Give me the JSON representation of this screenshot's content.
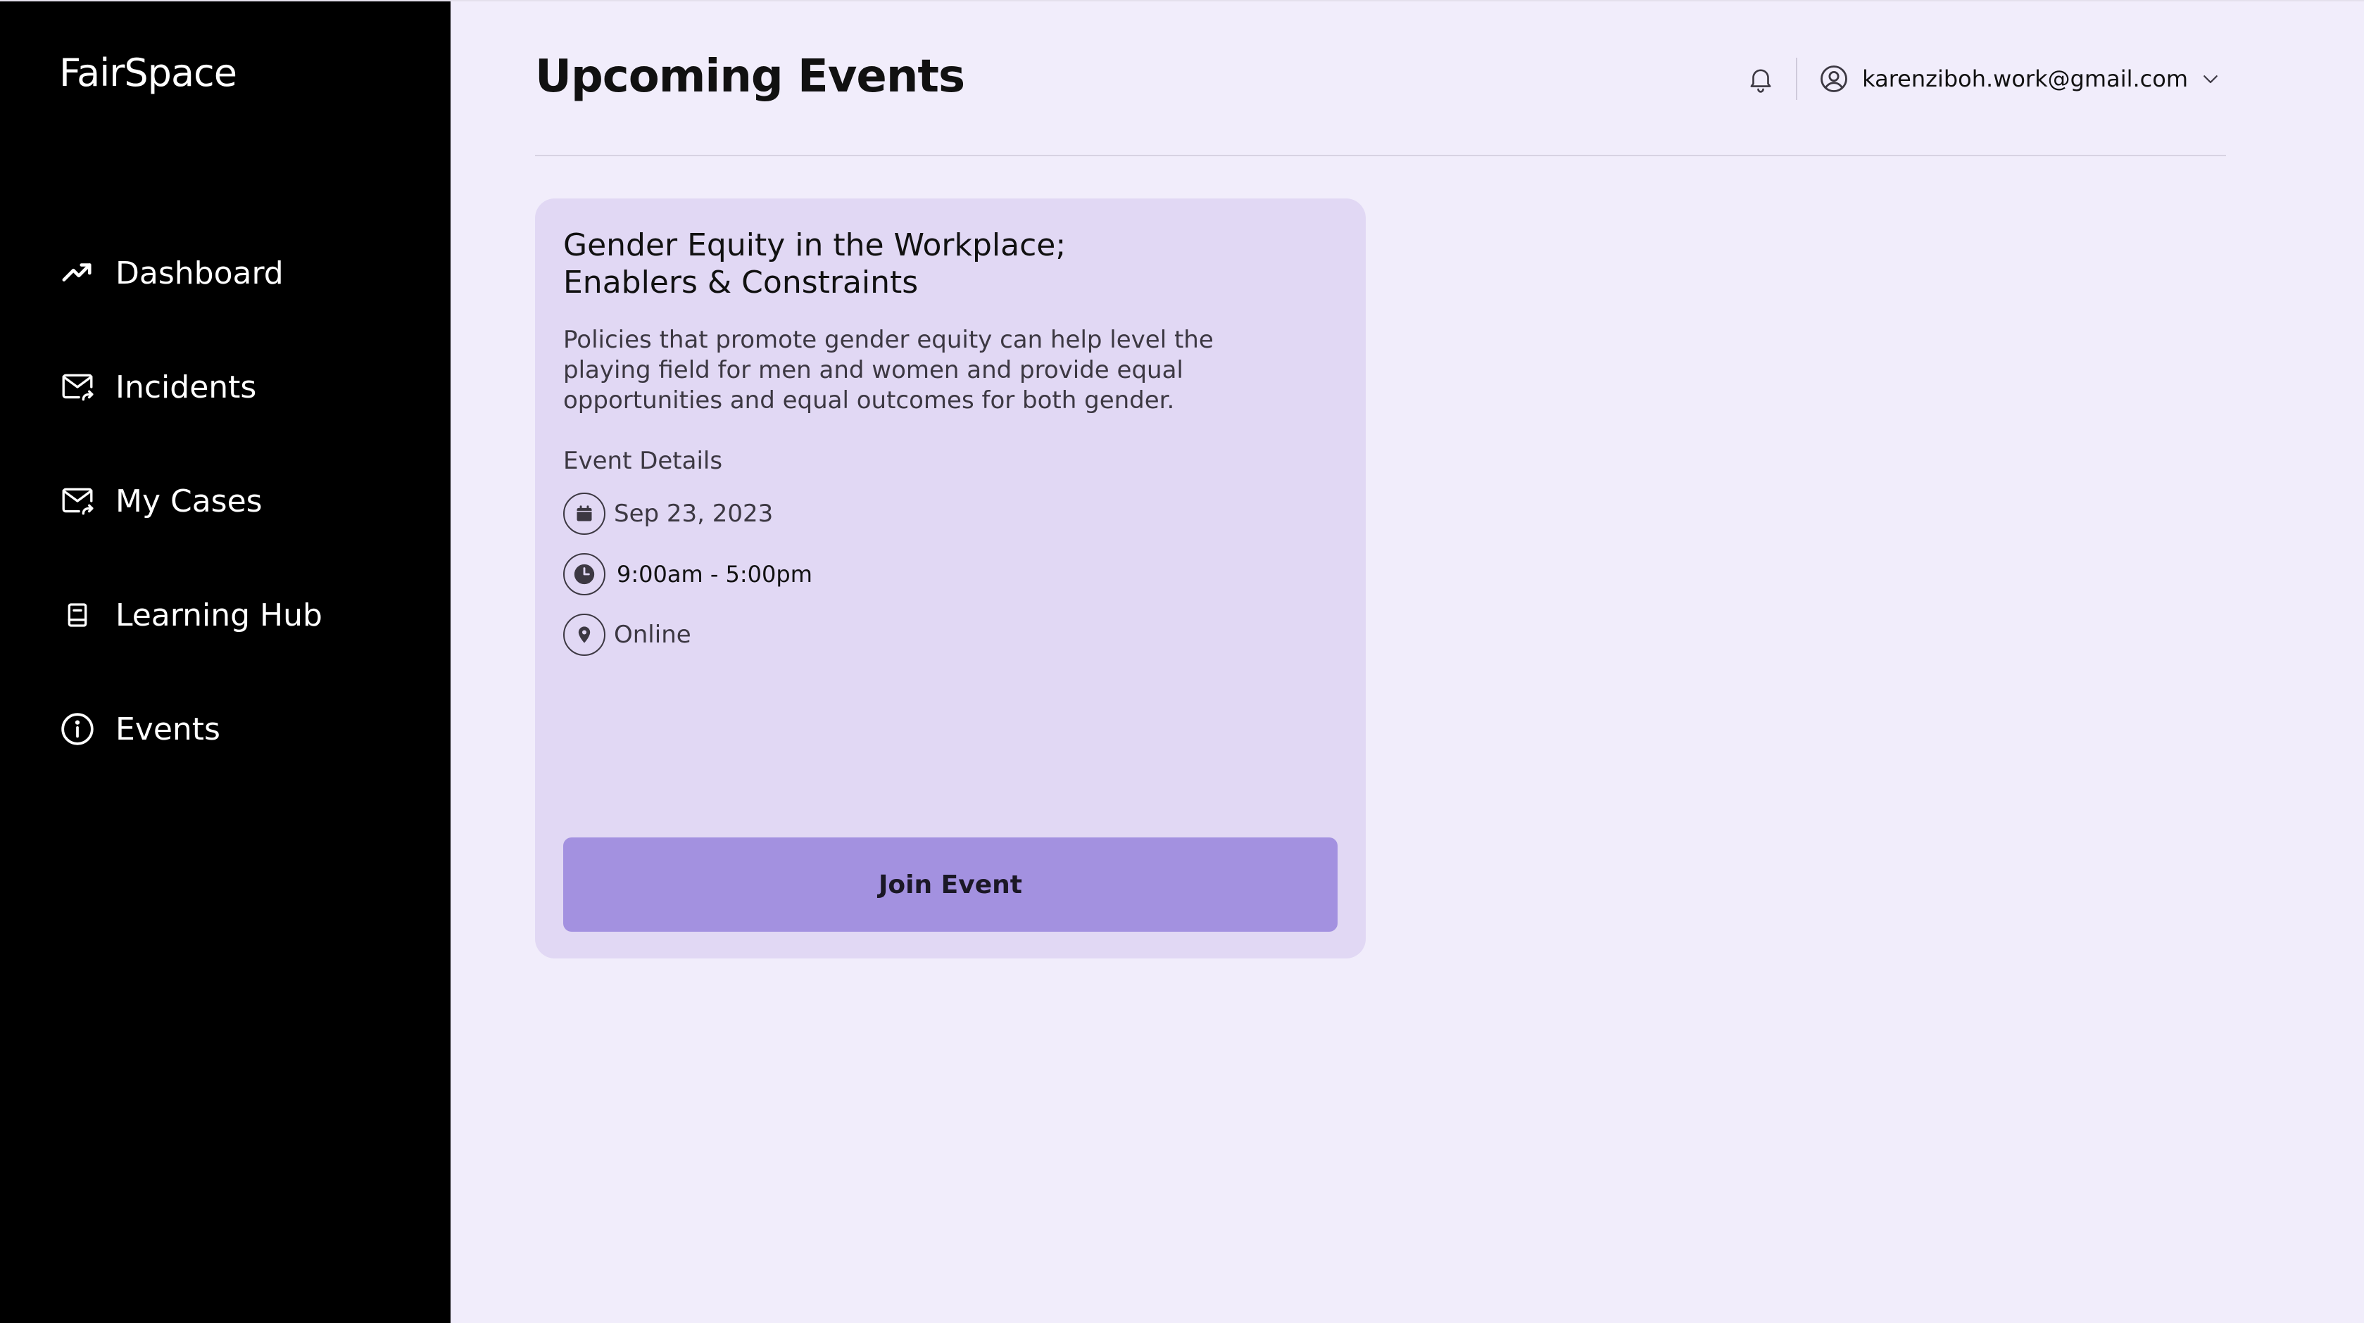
{
  "sidebar": {
    "brand": "FairSpace",
    "items": [
      {
        "label": "Dashboard",
        "icon": "trending-up-icon"
      },
      {
        "label": "Incidents",
        "icon": "mail-forward-icon"
      },
      {
        "label": "My Cases",
        "icon": "mail-forward-icon"
      },
      {
        "label": "Learning Hub",
        "icon": "book-icon"
      },
      {
        "label": "Events",
        "icon": "info-circle-icon"
      }
    ]
  },
  "header": {
    "title": "Upcoming Events",
    "user_email": "karenziboh.work@gmail.com",
    "icons": {
      "notifications": "bell-icon",
      "user": "user-circle-icon",
      "menu": "chevron-down-icon"
    }
  },
  "event_card": {
    "title": "Gender Equity in the Workplace; Enablers & Constraints",
    "description": "Policies that promote gender equity can help level the playing field for men and women and provide equal opportunities and equal outcomes for both gender.",
    "details_heading": "Event Details",
    "date": "Sep 23, 2023",
    "time": "9:00am - 5:00pm",
    "location": "Online",
    "icons": {
      "date": "calendar-icon",
      "time": "clock-icon",
      "location": "map-pin-icon"
    },
    "button_label": "Join Event"
  },
  "colors": {
    "sidebar_bg": "#000000",
    "main_bg": "#f1edfb",
    "card_bg": "#e1d8f4",
    "button_bg": "#a391e0",
    "text_dark": "#111111"
  }
}
